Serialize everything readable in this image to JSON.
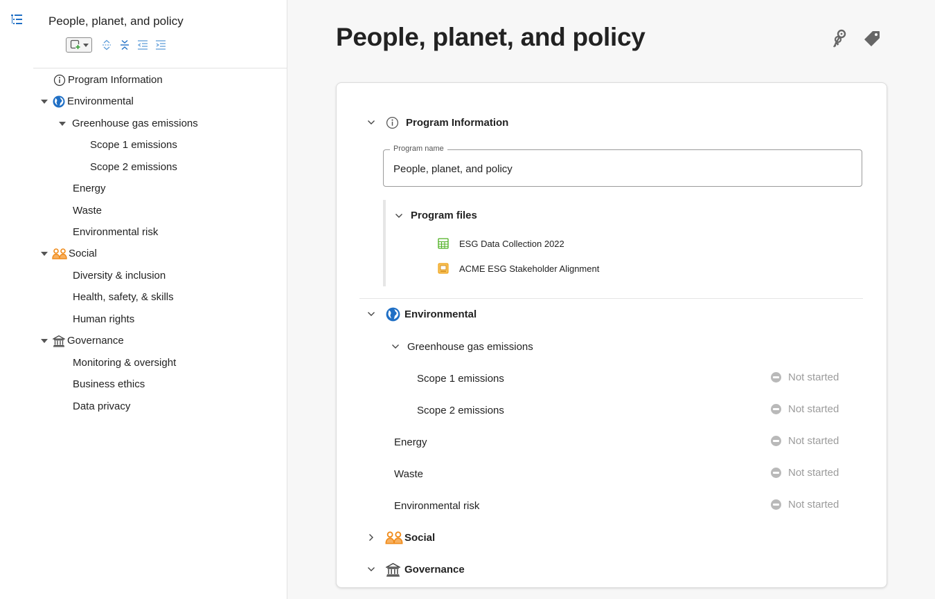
{
  "outline": {
    "title": "People, planet, and policy",
    "items": [
      {
        "label": "Program Information"
      },
      {
        "label": "Environmental"
      },
      {
        "label": "Greenhouse gas emissions"
      },
      {
        "label": "Scope 1 emissions"
      },
      {
        "label": "Scope 2 emissions"
      },
      {
        "label": "Energy"
      },
      {
        "label": "Waste"
      },
      {
        "label": "Environmental risk"
      },
      {
        "label": "Social"
      },
      {
        "label": "Diversity & inclusion"
      },
      {
        "label": "Health, safety, & skills"
      },
      {
        "label": "Human rights"
      },
      {
        "label": "Governance"
      },
      {
        "label": "Monitoring & oversight"
      },
      {
        "label": "Business ethics"
      },
      {
        "label": "Data privacy"
      }
    ]
  },
  "page": {
    "title": "People, planet, and policy"
  },
  "program_info": {
    "heading": "Program Information",
    "name_label": "Program name",
    "name_value": "People, planet, and policy"
  },
  "program_files": {
    "heading": "Program files",
    "files": [
      {
        "name": "ESG Data Collection 2022",
        "icon": "spreadsheet-icon",
        "color": "#4caf1e"
      },
      {
        "name": "ACME ESG Stakeholder Alignment",
        "icon": "presentation-icon",
        "color": "#f0a31c"
      }
    ]
  },
  "sections": {
    "environmental": "Environmental",
    "ghg": "Greenhouse gas emissions",
    "social": "Social",
    "governance": "Governance"
  },
  "tasks": [
    {
      "label": "Scope 1 emissions",
      "status": "Not started"
    },
    {
      "label": "Scope 2 emissions",
      "status": "Not started"
    },
    {
      "label": "Energy",
      "status": "Not started"
    },
    {
      "label": "Waste",
      "status": "Not started"
    },
    {
      "label": "Environmental risk",
      "status": "Not started"
    }
  ],
  "colors": {
    "accent": "#1f6fc5",
    "social": "#f08a18",
    "status_gray": "#b9b9b9"
  }
}
